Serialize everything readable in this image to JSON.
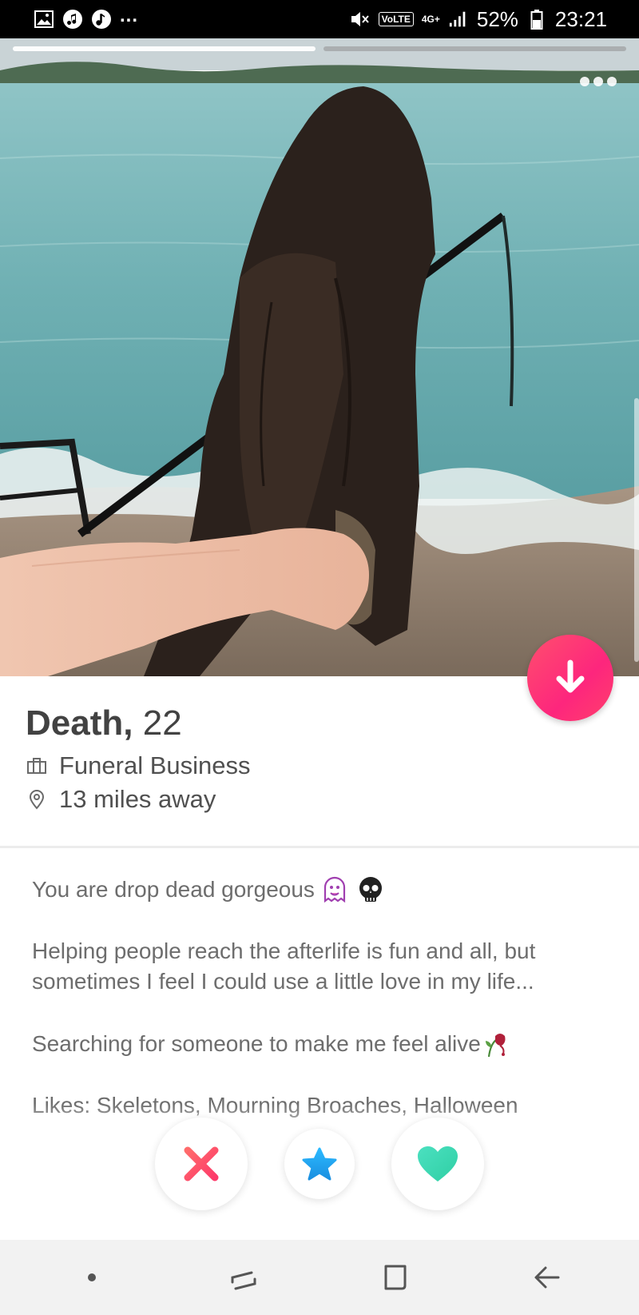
{
  "status_bar": {
    "network_label": "VoLTE",
    "network_type": "4G+",
    "battery": "52%",
    "time": "23:21",
    "overflow": "..."
  },
  "photo": {
    "total_photos": 2,
    "current_photo": 1
  },
  "profile": {
    "name": "Death,",
    "age": "22",
    "job": "Funeral Business",
    "distance": "13 miles away"
  },
  "bio": {
    "line1": "You are drop dead gorgeous",
    "line2": "Helping people reach the afterlife is fun and all, but sometimes I feel I could use a little love in my life...",
    "line3": "Searching for someone to make me feel alive",
    "line4": "Likes: Skeletons, Mourning Broaches, Halloween"
  },
  "actions": {
    "nope_icon": "x-icon",
    "superlike_icon": "star-icon",
    "like_icon": "heart-icon",
    "expand_icon": "arrow-down-icon"
  },
  "colors": {
    "brand_pink": "#fd267d",
    "nope_red": "#fd5068",
    "star_blue": "#1da1f2",
    "like_teal": "#3fd8b1"
  }
}
